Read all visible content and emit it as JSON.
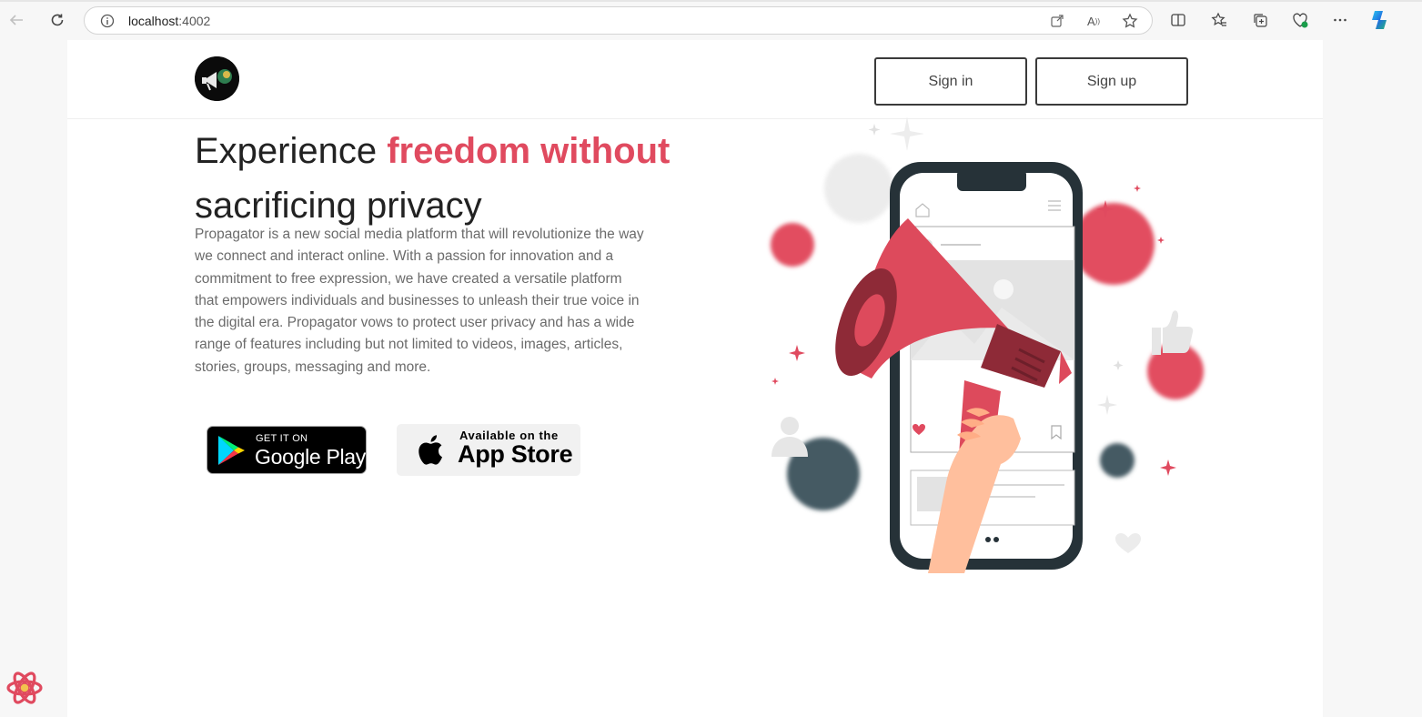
{
  "browser": {
    "url_host": "localhost",
    "url_port": ":4002"
  },
  "header": {
    "sign_in": "Sign in",
    "sign_up": "Sign up"
  },
  "hero": {
    "title_plain": "Experience ",
    "title_accent": "freedom without",
    "title_line2": "sacrificing privacy",
    "description": "Propagator is a new social media platform that will revolutionize the way we connect and interact online. With a passion for innovation and a commitment to free expression, we have created a versatile platform that empowers individuals and businesses to unleash their true voice in the digital era. Propagator vows to protect user privacy and has a wide range of features including but not limited to videos, images, articles, stories, groups, messaging and more."
  },
  "badges": {
    "google_small": "GET IT ON",
    "google_big": "Google Play",
    "apple_small": "Available on the",
    "apple_big": "App Store"
  },
  "colors": {
    "accent": "#e04a5f",
    "megaphone": "#dd4a5c",
    "dark_circle": "#455a64"
  }
}
